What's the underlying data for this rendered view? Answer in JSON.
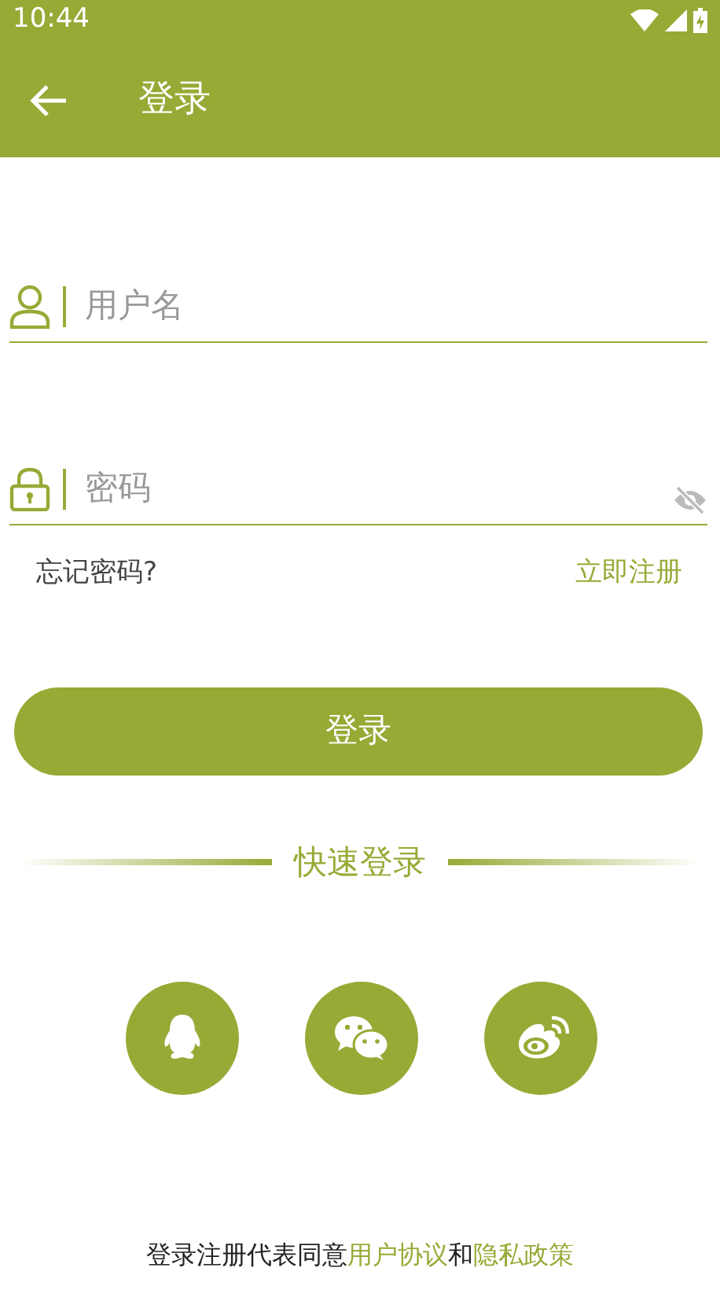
{
  "status_bar": {
    "time": "10:44"
  },
  "toolbar": {
    "title": "登录"
  },
  "fields": [
    {
      "kind": "user",
      "placeholder": "用户名"
    },
    {
      "kind": "password",
      "placeholder": "密码",
      "show_password": false
    }
  ],
  "forgot_password": "忘记密码?",
  "register": "立即注册",
  "login_button": "登录",
  "quick_login": {
    "title": "快速登录",
    "providers": [
      {
        "kind": "qq"
      },
      {
        "kind": "wechat"
      },
      {
        "kind": "weibo"
      }
    ]
  },
  "agreement": [
    {
      "text": "登录注册代表同意",
      "link": false
    },
    {
      "text": "用户协议",
      "link": true
    },
    {
      "text": "和",
      "link": false
    },
    {
      "text": "隐私政策",
      "link": true
    }
  ]
}
